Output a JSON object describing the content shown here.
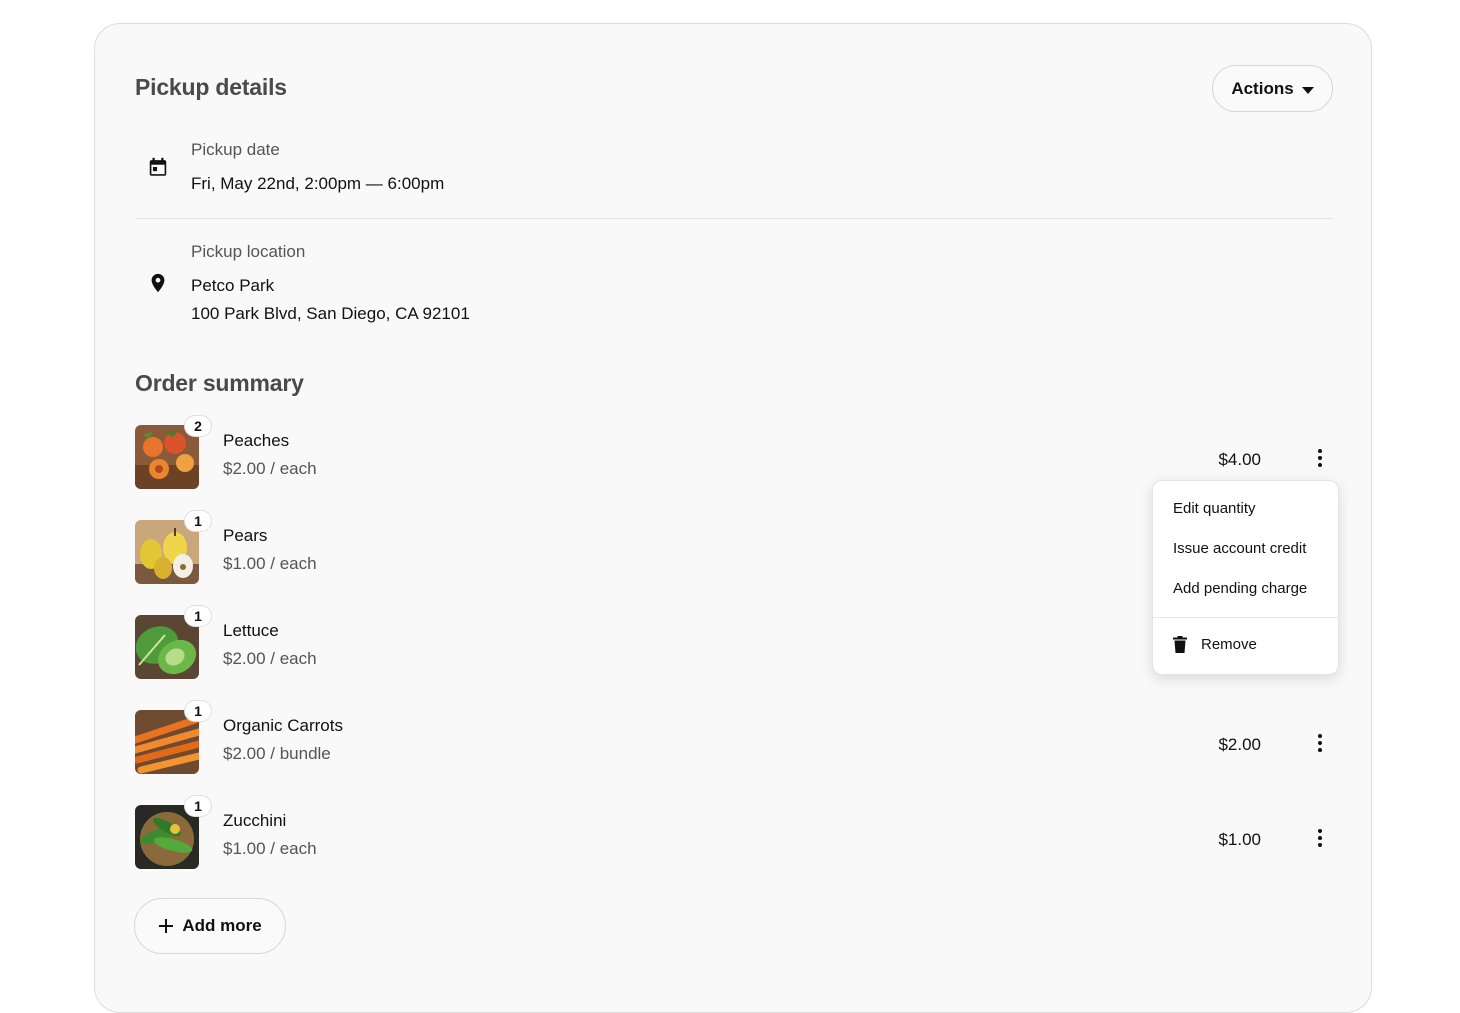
{
  "pickup": {
    "title": "Pickup details",
    "actions_label": "Actions",
    "date_label": "Pickup date",
    "date_value": "Fri, May 22nd, 2:00pm — 6:00pm",
    "location_label": "Pickup location",
    "location_name": "Petco Park",
    "location_address": "100 Park Blvd, San Diego, CA 92101"
  },
  "order": {
    "title": "Order summary",
    "items": [
      {
        "qty": "2",
        "name": "Peaches",
        "unit": "$2.00 / each",
        "total": "$4.00",
        "image": "peaches"
      },
      {
        "qty": "1",
        "name": "Pears",
        "unit": "$1.00 / each",
        "total": "",
        "image": "pears"
      },
      {
        "qty": "1",
        "name": "Lettuce",
        "unit": "$2.00 / each",
        "total": "",
        "image": "lettuce"
      },
      {
        "qty": "1",
        "name": "Organic Carrots",
        "unit": "$2.00 / bundle",
        "total": "$2.00",
        "image": "carrots"
      },
      {
        "qty": "1",
        "name": "Zucchini",
        "unit": "$1.00 / each",
        "total": "$1.00",
        "image": "zucchini"
      }
    ],
    "add_more_label": "Add more"
  },
  "menu": {
    "edit_quantity": "Edit quantity",
    "issue_credit": "Issue account credit",
    "add_pending_charge": "Add pending charge",
    "remove": "Remove"
  },
  "icons": {
    "calendar": "calendar-icon",
    "location": "location-pin-icon",
    "kebab": "more-vertical-icon",
    "trash": "trash-icon",
    "plus": "plus-icon",
    "caret": "caret-down-icon"
  }
}
